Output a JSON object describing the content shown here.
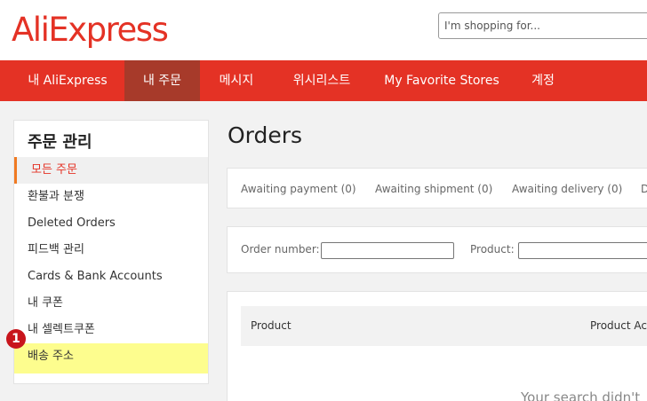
{
  "header": {
    "logo": "AliExpress",
    "search_placeholder": "I'm shopping for..."
  },
  "nav": {
    "items": [
      "내 AliExpress",
      "내 주문",
      "메시지",
      "위시리스트",
      "My Favorite Stores",
      "계정"
    ],
    "active": "내 주문"
  },
  "sidebar": {
    "title": "주문 관리",
    "items": [
      "모든 주문",
      "환불과 분쟁",
      "Deleted Orders",
      "피드백 관리",
      "Cards & Bank Accounts",
      "내 쿠폰",
      "내 셀렉트쿠폰",
      "배송 주소"
    ],
    "active": "모든 주문",
    "highlighted": "배송 주소"
  },
  "annotation": {
    "step": "1"
  },
  "main": {
    "title": "Orders",
    "tabs": [
      "Awaiting payment (0)",
      "Awaiting shipment (0)",
      "Awaiting delivery (0)",
      "D"
    ],
    "filter": {
      "order_number_label": "Order number:",
      "product_label": "Product:"
    },
    "table": {
      "columns": [
        "Product",
        "Product Act"
      ]
    },
    "empty_message": "Your search didn't"
  },
  "colors": {
    "brand": "#e43225",
    "nav_active": "#a73a2a",
    "highlight": "#fdfd8e",
    "badge": "#c8151c",
    "sidebar_active_border": "#f07a22"
  }
}
